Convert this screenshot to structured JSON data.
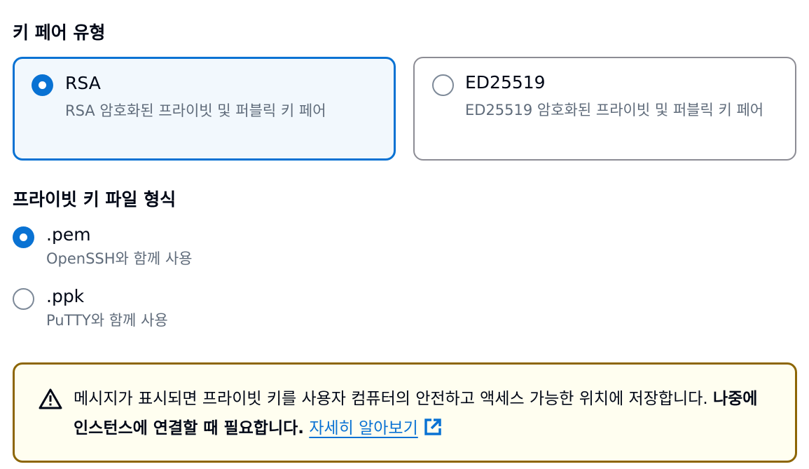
{
  "key_type": {
    "title": "키 페어 유형",
    "options": [
      {
        "label": "RSA",
        "description": "RSA 암호화된 프라이빗 및 퍼블릭 키 페어",
        "selected": true
      },
      {
        "label": "ED25519",
        "description": "ED25519 암호화된 프라이빗 및 퍼블릭 키 페어",
        "selected": false
      }
    ]
  },
  "file_format": {
    "title": "프라이빗 키 파일 형식",
    "options": [
      {
        "label": ".pem",
        "description": "OpenSSH와 함께 사용",
        "selected": true
      },
      {
        "label": ".ppk",
        "description": "PuTTY와 함께 사용",
        "selected": false
      }
    ]
  },
  "alert": {
    "icon": "warning-icon",
    "text": "메시지가 표시되면 프라이빗 키를 사용자 컴퓨터의 안전하고 액세스 가능한 위치에 저장합니다.",
    "bold_text": "나중에 인스턴스에 연결할 때 필요합니다.",
    "link_text": "자세히 알아보기",
    "link_icon": "external-link-icon"
  },
  "colors": {
    "accent": "#0972d3",
    "selected_tile_bg": "#f2f8fd",
    "warning_border": "#8d6605",
    "warning_bg": "#fffef0",
    "secondary_text": "#5f6b7a"
  }
}
